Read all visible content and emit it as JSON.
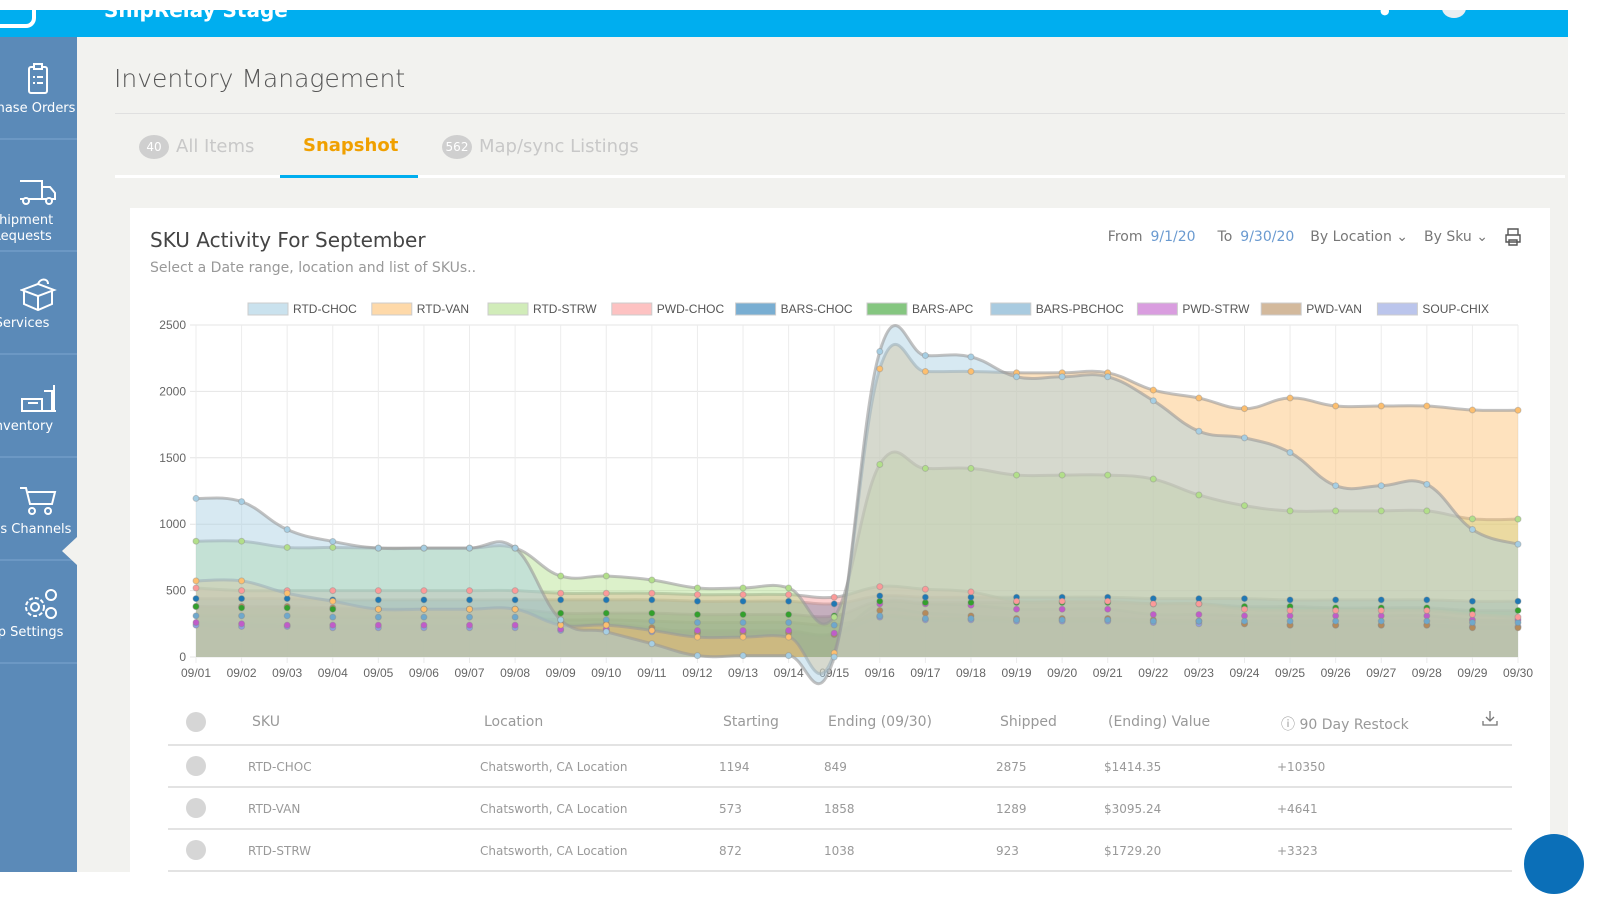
{
  "app": {
    "title": "ShipRelay Stage"
  },
  "sidebar": {
    "items": [
      {
        "label": "Purchase Orders",
        "icon": "clipboard-icon"
      },
      {
        "label": "Shipment Requests",
        "icon": "truck-icon"
      },
      {
        "label": "Services",
        "icon": "gift-box-icon"
      },
      {
        "label": "Inventory",
        "icon": "warehouse-icon"
      },
      {
        "label": "Sales Channels",
        "icon": "cart-icon"
      },
      {
        "label": "App Settings",
        "icon": "gears-icon"
      }
    ]
  },
  "page": {
    "title": "Inventory Management"
  },
  "tabs": [
    {
      "badge": "40",
      "label": "All Items"
    },
    {
      "label": "Snapshot"
    },
    {
      "badge": "562",
      "label": "Map/sync Listings"
    }
  ],
  "card": {
    "title": "SKU Activity For September",
    "subtitle": "Select a Date range, location and list of SKUs..",
    "from_label": "From",
    "from": "9/1/20",
    "to_label": "To",
    "to": "9/30/20",
    "location_dd": "By Location",
    "sku_dd": "By Sku"
  },
  "chart_data": {
    "type": "area",
    "x": [
      "09/01",
      "09/02",
      "09/03",
      "09/04",
      "09/05",
      "09/06",
      "09/07",
      "09/08",
      "09/09",
      "09/10",
      "09/11",
      "09/12",
      "09/13",
      "09/14",
      "09/15",
      "09/16",
      "09/17",
      "09/18",
      "09/19",
      "09/20",
      "09/21",
      "09/22",
      "09/23",
      "09/24",
      "09/25",
      "09/26",
      "09/27",
      "09/28",
      "09/29",
      "09/30"
    ],
    "ylim": [
      0,
      2500
    ],
    "yticks": [
      0,
      500,
      1000,
      1500,
      2000,
      2500
    ],
    "grid": true,
    "legend": "top",
    "series": [
      {
        "name": "RTD-CHOC",
        "color": "#a6cee3",
        "values": [
          1194,
          1170,
          960,
          870,
          820,
          820,
          820,
          820,
          280,
          190,
          100,
          10,
          10,
          10,
          0,
          2300,
          2270,
          2260,
          2110,
          2110,
          2110,
          1930,
          1700,
          1650,
          1540,
          1290,
          1290,
          1300,
          960,
          849
        ]
      },
      {
        "name": "RTD-VAN",
        "color": "#fdbf6f",
        "values": [
          573,
          573,
          480,
          420,
          360,
          360,
          360,
          360,
          240,
          240,
          200,
          150,
          150,
          150,
          30,
          2170,
          2150,
          2150,
          2140,
          2140,
          2140,
          2010,
          1950,
          1870,
          1950,
          1890,
          1890,
          1890,
          1860,
          1858
        ]
      },
      {
        "name": "RTD-STRW",
        "color": "#b2df8a",
        "values": [
          872,
          872,
          825,
          825,
          820,
          820,
          820,
          820,
          610,
          610,
          580,
          520,
          520,
          520,
          300,
          1450,
          1420,
          1420,
          1370,
          1370,
          1370,
          1340,
          1220,
          1140,
          1100,
          1100,
          1100,
          1100,
          1040,
          1038
        ]
      },
      {
        "name": "PWD-CHOC",
        "color": "#fb9a99",
        "values": [
          520,
          500,
          500,
          500,
          500,
          500,
          500,
          500,
          480,
          480,
          480,
          470,
          470,
          470,
          450,
          530,
          510,
          490,
          420,
          420,
          420,
          400,
          400,
          360,
          350,
          350,
          350,
          350,
          320,
          300
        ]
      },
      {
        "name": "BARS-CHOC",
        "color": "#1f78b4",
        "values": [
          440,
          440,
          440,
          430,
          430,
          430,
          430,
          430,
          430,
          430,
          430,
          420,
          420,
          420,
          400,
          460,
          450,
          450,
          450,
          450,
          450,
          440,
          440,
          440,
          430,
          430,
          430,
          430,
          420,
          420
        ]
      },
      {
        "name": "BARS-APC",
        "color": "#33a02c",
        "values": [
          380,
          370,
          370,
          360,
          360,
          360,
          360,
          360,
          330,
          330,
          330,
          320,
          320,
          320,
          310,
          420,
          410,
          410,
          410,
          410,
          410,
          400,
          400,
          380,
          380,
          370,
          370,
          370,
          350,
          350
        ]
      },
      {
        "name": "BARS-PBCHOC",
        "color": "#6fa8cc",
        "values": [
          310,
          310,
          310,
          300,
          300,
          300,
          300,
          300,
          280,
          280,
          270,
          260,
          260,
          260,
          240,
          310,
          290,
          290,
          280,
          280,
          280,
          270,
          270,
          270,
          270,
          270,
          270,
          270,
          260,
          260
        ]
      },
      {
        "name": "PWD-STRW",
        "color": "#c05cc9",
        "values": [
          260,
          250,
          240,
          240,
          240,
          240,
          240,
          240,
          210,
          210,
          200,
          200,
          200,
          200,
          180,
          400,
          400,
          390,
          360,
          360,
          360,
          320,
          320,
          310,
          310,
          310,
          310,
          310,
          280,
          280
        ]
      },
      {
        "name": "PWD-VAN",
        "color": "#b58a5a",
        "values": [
          380,
          380,
          380,
          370,
          360,
          360,
          360,
          360,
          250,
          250,
          220,
          180,
          180,
          180,
          170,
          350,
          330,
          310,
          290,
          290,
          290,
          280,
          270,
          250,
          240,
          240,
          240,
          240,
          220,
          220
        ]
      },
      {
        "name": "SOUP-CHIX",
        "color": "#8e9ee0",
        "values": [
          240,
          230,
          230,
          220,
          220,
          220,
          220,
          220,
          200,
          200,
          190,
          190,
          190,
          190,
          170,
          300,
          280,
          280,
          270,
          270,
          270,
          260,
          250,
          250,
          240,
          240,
          240,
          240,
          230,
          230
        ]
      }
    ]
  },
  "table": {
    "headers": [
      "SKU",
      "Location",
      "Starting",
      "Ending (09/30)",
      "Shipped",
      "(Ending) Value",
      "90 Day Restock"
    ],
    "rows": [
      [
        "RTD-CHOC",
        "Chatsworth, CA Location",
        "1194",
        "849",
        "2875",
        "$1414.35",
        "+10350"
      ],
      [
        "RTD-VAN",
        "Chatsworth, CA Location",
        "573",
        "1858",
        "1289",
        "$3095.24",
        "+4641"
      ],
      [
        "RTD-STRW",
        "Chatsworth, CA Location",
        "872",
        "1038",
        "923",
        "$1729.20",
        "+3323"
      ]
    ]
  }
}
